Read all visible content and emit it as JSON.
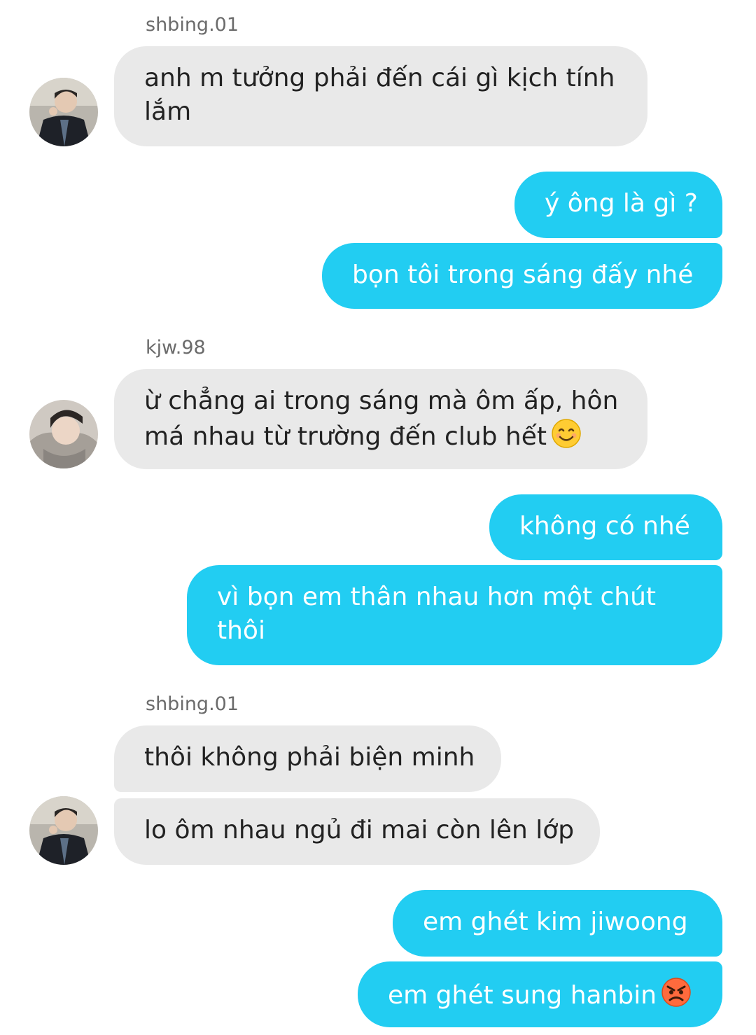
{
  "chat": {
    "groups": [
      {
        "sender": "shbing.01",
        "messages": [
          "anh m tưởng phải đến cái gì kịch tính lắm"
        ]
      },
      {
        "outgoing": [
          "ý ông là gì ?",
          "bọn tôi trong sáng đấy nhé"
        ]
      },
      {
        "sender": "kjw.98",
        "messages": [
          "ừ chẳng ai trong sáng mà ôm ấp, hôn má nhau từ trường đến club hết"
        ],
        "emoji": "smiling-face-icon"
      },
      {
        "outgoing": [
          "không có nhé",
          "vì bọn em thân nhau hơn một chút thôi"
        ]
      },
      {
        "sender": "shbing.01",
        "messages": [
          "thôi không phải biện minh",
          "lo ôm nhau ngủ đi mai còn lên lớp"
        ]
      },
      {
        "outgoing": [
          "em ghét kim jiwoong",
          "em ghét sung hanbin"
        ],
        "emoji": "angry-face-icon"
      }
    ]
  },
  "colors": {
    "outgoing_bubble": "#22cdf2",
    "incoming_bubble": "#e9e9e9",
    "sender_name": "#6b6b6b"
  }
}
